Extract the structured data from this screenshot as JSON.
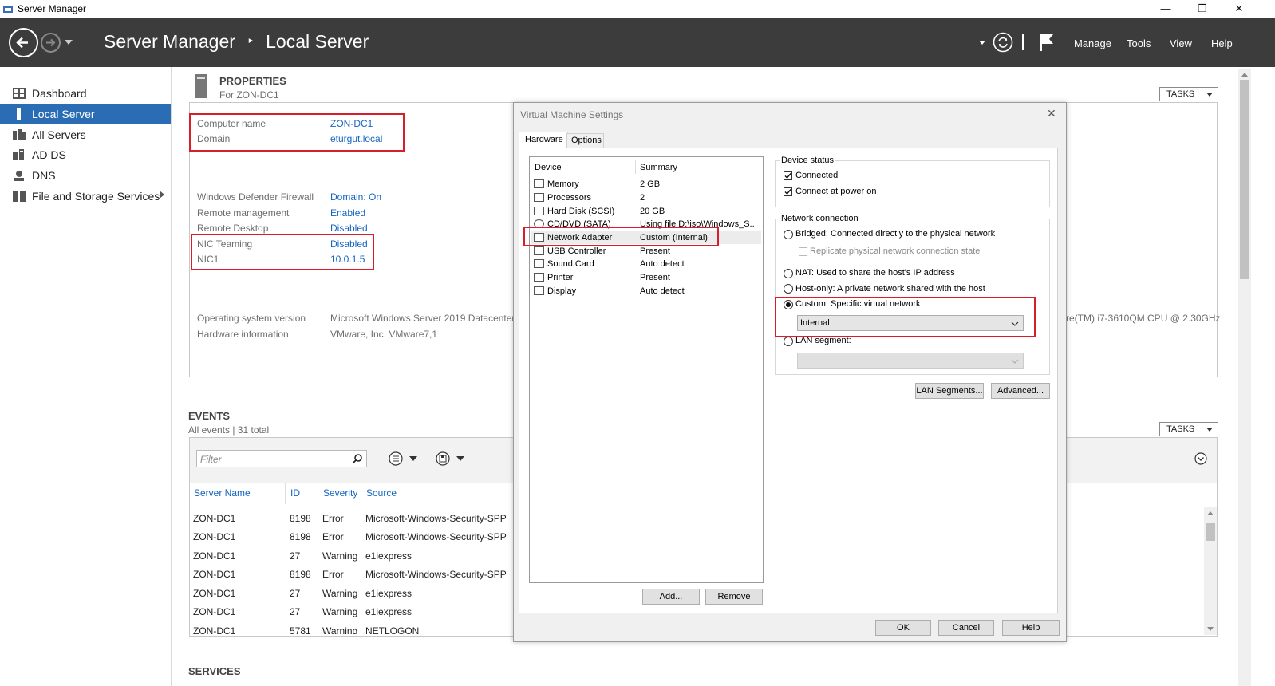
{
  "window": {
    "title": "Server Manager",
    "minimize": "—",
    "restore": "❐",
    "close": "✕"
  },
  "header": {
    "title": "Server Manager",
    "separator": "‣",
    "page": "Local Server",
    "menu": [
      "Manage",
      "Tools",
      "View",
      "Help"
    ]
  },
  "sidebar": {
    "items": [
      {
        "label": "Dashboard",
        "icon": "dashboard-icon"
      },
      {
        "label": "Local Server",
        "icon": "server-icon"
      },
      {
        "label": "All Servers",
        "icon": "servers-icon"
      },
      {
        "label": "AD DS",
        "icon": "adds-icon"
      },
      {
        "label": "DNS",
        "icon": "dns-icon"
      },
      {
        "label": "File and Storage Services",
        "icon": "storage-icon"
      }
    ],
    "active": "Local Server"
  },
  "properties": {
    "heading": "PROPERTIES",
    "subheading": "For ZON-DC1",
    "tasks_label": "TASKS",
    "rows": [
      {
        "label": "Computer name",
        "value": "ZON-DC1"
      },
      {
        "label": "Domain",
        "value": "eturgut.local"
      },
      {
        "label": "Windows Defender Firewall",
        "value": "Domain: On"
      },
      {
        "label": "Remote management",
        "value": "Enabled"
      },
      {
        "label": "Remote Desktop",
        "value": "Disabled"
      },
      {
        "label": "NIC Teaming",
        "value": "Disabled"
      },
      {
        "label": "NIC1",
        "value": "10.0.1.5"
      },
      {
        "label": "Operating system version",
        "value": "Microsoft Windows Server 2019 Datacenter"
      },
      {
        "label": "Hardware information",
        "value": "VMware, Inc. VMware7,1"
      }
    ],
    "cpu_text": "re(TM) i7-3610QM CPU @ 2.30GHz"
  },
  "events": {
    "heading": "EVENTS",
    "subheading": "All events | 31 total",
    "tasks_label": "TASKS",
    "filter_placeholder": "Filter",
    "columns": [
      "Server Name",
      "ID",
      "Severity",
      "Source"
    ],
    "rows": [
      [
        "ZON-DC1",
        "8198",
        "Error",
        "Microsoft-Windows-Security-SPP"
      ],
      [
        "ZON-DC1",
        "8198",
        "Error",
        "Microsoft-Windows-Security-SPP"
      ],
      [
        "ZON-DC1",
        "27",
        "Warning",
        "e1iexpress"
      ],
      [
        "ZON-DC1",
        "8198",
        "Error",
        "Microsoft-Windows-Security-SPP"
      ],
      [
        "ZON-DC1",
        "27",
        "Warning",
        "e1iexpress"
      ],
      [
        "ZON-DC1",
        "27",
        "Warning",
        "e1iexpress"
      ],
      [
        "ZON-DC1",
        "5781",
        "Warning",
        "NETLOGON"
      ]
    ]
  },
  "services": {
    "heading": "SERVICES"
  },
  "dialog": {
    "title": "Virtual Machine Settings",
    "close": "✕",
    "tabs": [
      "Hardware",
      "Options"
    ],
    "device_header": "Device",
    "summary_header": "Summary",
    "devices": [
      {
        "name": "Memory",
        "summary": "2 GB"
      },
      {
        "name": "Processors",
        "summary": "2"
      },
      {
        "name": "Hard Disk (SCSI)",
        "summary": "20 GB"
      },
      {
        "name": "CD/DVD (SATA)",
        "summary": "Using file D:\\iso\\Windows_S..."
      },
      {
        "name": "Network Adapter",
        "summary": "Custom (Internal)"
      },
      {
        "name": "USB Controller",
        "summary": "Present"
      },
      {
        "name": "Sound Card",
        "summary": "Auto detect"
      },
      {
        "name": "Printer",
        "summary": "Present"
      },
      {
        "name": "Display",
        "summary": "Auto detect"
      }
    ],
    "selected_device": "Network Adapter",
    "add_label": "Add...",
    "remove_label": "Remove",
    "device_status": {
      "title": "Device status",
      "connected": "Connected",
      "connect_at_power_on": "Connect at power on"
    },
    "network_connection": {
      "title": "Network connection",
      "bridged": "Bridged: Connected directly to the physical network",
      "replicate": "Replicate physical network connection state",
      "nat": "NAT: Used to share the host's IP address",
      "host_only": "Host-only: A private network shared with the host",
      "custom": "Custom: Specific virtual network",
      "custom_value": "Internal",
      "lan_segment": "LAN segment:",
      "selected": "custom"
    },
    "lan_segments_label": "LAN Segments...",
    "advanced_label": "Advanced...",
    "ok_label": "OK",
    "cancel_label": "Cancel",
    "help_label": "Help"
  },
  "colors": {
    "header_bg": "#3c3c3c",
    "active_nav": "#2a6db5",
    "link": "#1565c0",
    "highlight_box": "#d81e2a"
  }
}
